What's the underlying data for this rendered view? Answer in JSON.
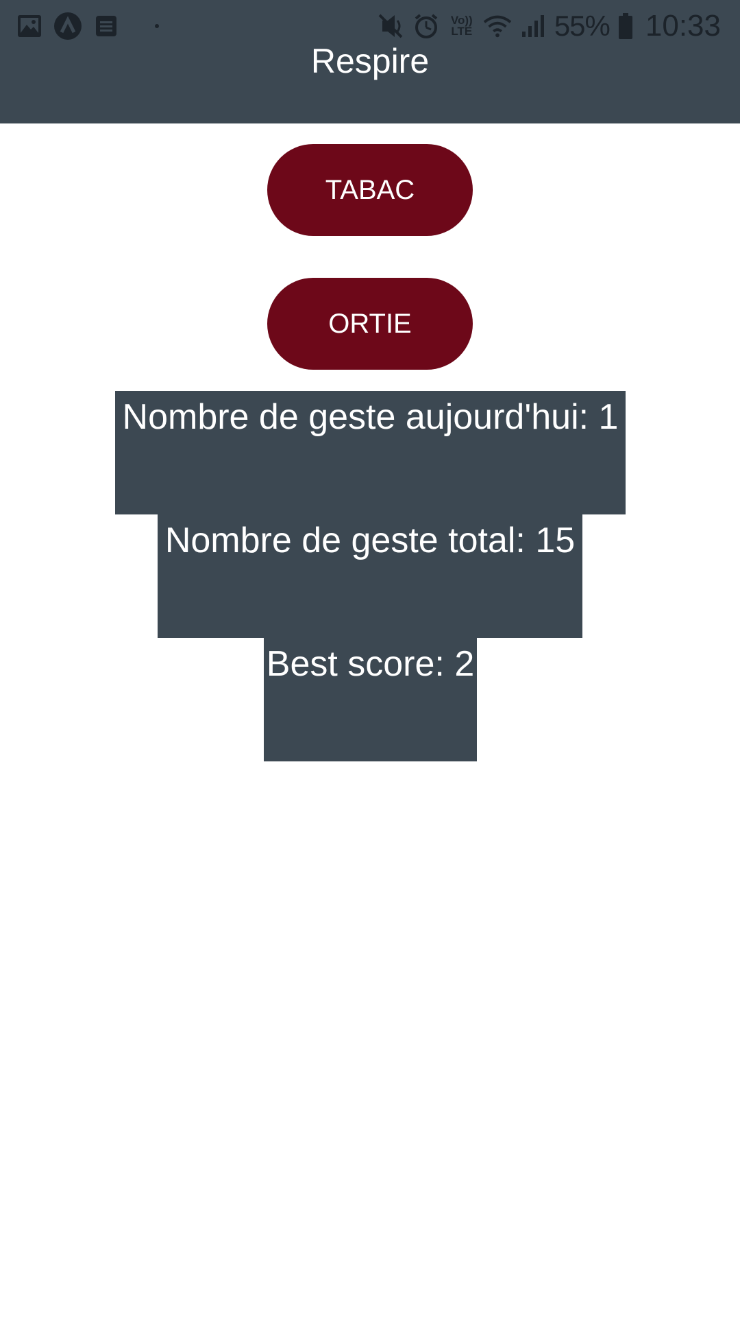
{
  "status_bar": {
    "battery_percent": "55%",
    "time": "10:33",
    "network_label_top": "Vo))",
    "network_label_bottom": "LTE",
    "left_icons": [
      "gallery-icon",
      "app-logo-icon",
      "notes-icon",
      "notification-dot"
    ],
    "right_icons": [
      "mute-icon",
      "alarm-icon",
      "volte-icon",
      "wifi-icon",
      "signal-icon",
      "battery-icon"
    ]
  },
  "app_bar": {
    "title": "Respire",
    "color": "#3c4852"
  },
  "buttons": {
    "tabac_label": "TABAC",
    "ortie_label": "ORTIE",
    "color": "#6d0819"
  },
  "stats": {
    "today_label": "Nombre de geste aujourd'hui: 1",
    "total_label": "Nombre de geste total: 15",
    "best_label": "Best score: 2"
  }
}
